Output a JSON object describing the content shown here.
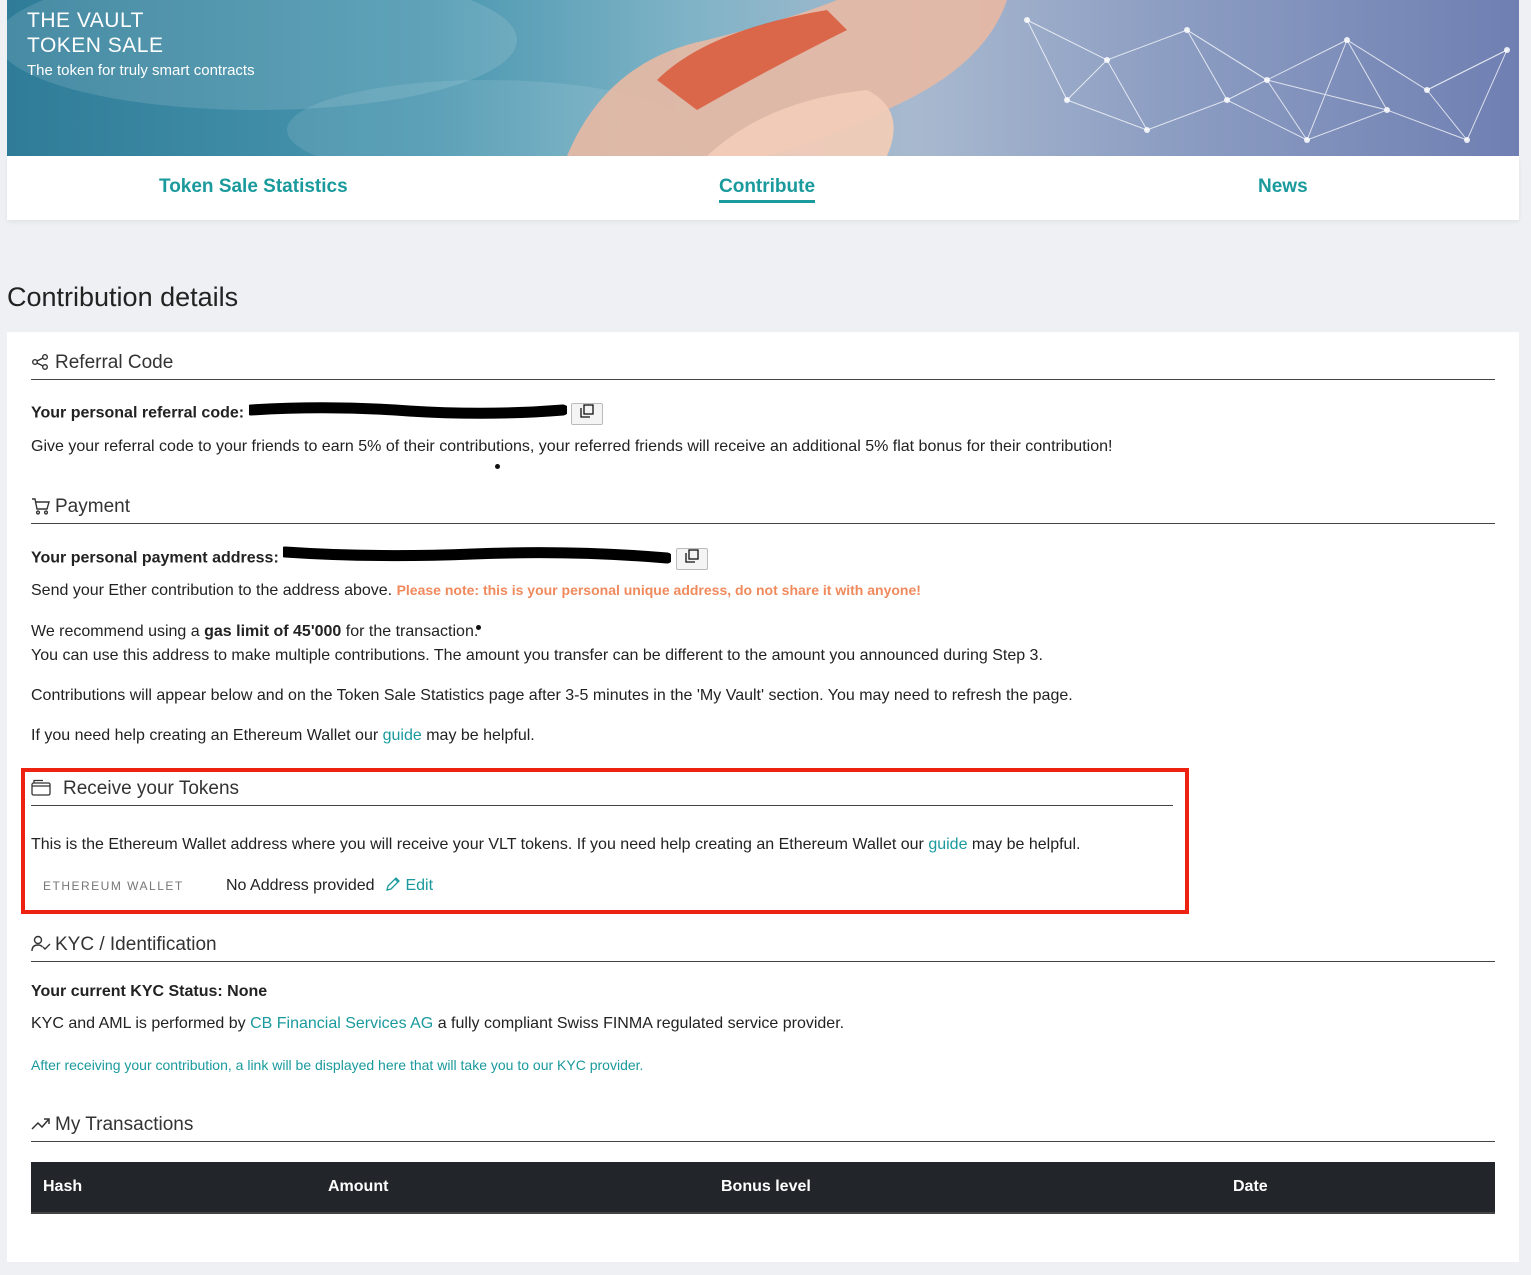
{
  "hero": {
    "title_line1": "THE VAULT",
    "title_line2": "TOKEN SALE",
    "subtitle": "The token for truly smart contracts"
  },
  "nav": {
    "tabs": [
      {
        "label": "Token Sale Statistics",
        "active": false
      },
      {
        "label": "Contribute",
        "active": true
      },
      {
        "label": "News",
        "active": false
      }
    ]
  },
  "page": {
    "title": "Contribution details"
  },
  "referral": {
    "heading": "Referral Code",
    "code_label": "Your personal referral code:",
    "description": "Give your referral code to your friends to earn 5% of their contributions, your referred friends will receive an additional 5% flat bonus for their contribution!"
  },
  "payment": {
    "heading": "Payment",
    "address_label": "Your personal payment address:",
    "send_text": "Send your Ether contribution to the address above.",
    "warning": "Please note: this is your personal unique address, do not share it with anyone!",
    "gas_prefix": "We recommend using a ",
    "gas_bold": "gas limit of 45'000",
    "gas_suffix": " for the transaction.",
    "multiple_text": "You can use this address to make multiple contributions. The amount you transfer can be different to the amount you announced during Step 3.",
    "appear_text": "Contributions will appear below and on the Token Sale Statistics page after 3-5 minutes in the 'My Vault' section. You may need to refresh the page.",
    "help_prefix": "If you need help creating an Ethereum Wallet our ",
    "help_link": "guide",
    "help_suffix": " may be helpful."
  },
  "receive": {
    "heading": "Receive your Tokens",
    "desc_prefix": "This is the Ethereum Wallet address where you will receive your VLT tokens. If you need help creating an Ethereum Wallet our ",
    "desc_link": "guide",
    "desc_suffix": " may be helpful.",
    "wallet_label": "ETHEREUM WALLET",
    "wallet_value": "No Address provided",
    "edit_label": "Edit"
  },
  "kyc": {
    "heading": "KYC / Identification",
    "status": "Your current KYC Status: None",
    "desc_prefix": "KYC and AML is performed by ",
    "desc_link": "CB Financial Services AG",
    "desc_suffix": " a fully compliant Swiss FINMA regulated service provider.",
    "note": "After receiving your contribution, a link will be displayed here that will take you to our KYC provider."
  },
  "transactions": {
    "heading": "My Transactions",
    "columns": [
      "Hash",
      "Amount",
      "Bonus level",
      "Date"
    ]
  },
  "colors": {
    "accent": "#1a9a9c",
    "warning": "#f08a5d",
    "highlight": "#ee2211",
    "table_header": "#222529"
  }
}
